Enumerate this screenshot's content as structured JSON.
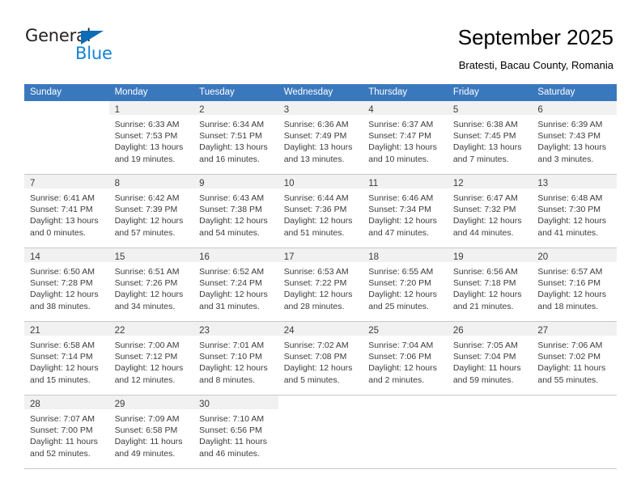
{
  "brand": {
    "name_top": "General",
    "name_bottom": "Blue",
    "triangle_color": "#0d6cb5",
    "text_color_top": "#231f20",
    "text_color_bottom": "#1583d4"
  },
  "header": {
    "title": "September 2025",
    "subtitle": "Bratesti, Bacau County, Romania"
  },
  "theme": {
    "header_bg": "#3a78bd",
    "header_text": "#ffffff",
    "daynum_band_bg": "#f1f1f1",
    "cell_border": "#c8c8c8",
    "text": "#3c3c3c"
  },
  "weekdays": [
    "Sunday",
    "Monday",
    "Tuesday",
    "Wednesday",
    "Thursday",
    "Friday",
    "Saturday"
  ],
  "weeks": [
    [
      {
        "day": "",
        "sunrise": "",
        "sunset": "",
        "daylight_1": "",
        "daylight_2": ""
      },
      {
        "day": "1",
        "sunrise": "Sunrise: 6:33 AM",
        "sunset": "Sunset: 7:53 PM",
        "daylight_1": "Daylight: 13 hours",
        "daylight_2": "and 19 minutes."
      },
      {
        "day": "2",
        "sunrise": "Sunrise: 6:34 AM",
        "sunset": "Sunset: 7:51 PM",
        "daylight_1": "Daylight: 13 hours",
        "daylight_2": "and 16 minutes."
      },
      {
        "day": "3",
        "sunrise": "Sunrise: 6:36 AM",
        "sunset": "Sunset: 7:49 PM",
        "daylight_1": "Daylight: 13 hours",
        "daylight_2": "and 13 minutes."
      },
      {
        "day": "4",
        "sunrise": "Sunrise: 6:37 AM",
        "sunset": "Sunset: 7:47 PM",
        "daylight_1": "Daylight: 13 hours",
        "daylight_2": "and 10 minutes."
      },
      {
        "day": "5",
        "sunrise": "Sunrise: 6:38 AM",
        "sunset": "Sunset: 7:45 PM",
        "daylight_1": "Daylight: 13 hours",
        "daylight_2": "and 7 minutes."
      },
      {
        "day": "6",
        "sunrise": "Sunrise: 6:39 AM",
        "sunset": "Sunset: 7:43 PM",
        "daylight_1": "Daylight: 13 hours",
        "daylight_2": "and 3 minutes."
      }
    ],
    [
      {
        "day": "7",
        "sunrise": "Sunrise: 6:41 AM",
        "sunset": "Sunset: 7:41 PM",
        "daylight_1": "Daylight: 13 hours",
        "daylight_2": "and 0 minutes."
      },
      {
        "day": "8",
        "sunrise": "Sunrise: 6:42 AM",
        "sunset": "Sunset: 7:39 PM",
        "daylight_1": "Daylight: 12 hours",
        "daylight_2": "and 57 minutes."
      },
      {
        "day": "9",
        "sunrise": "Sunrise: 6:43 AM",
        "sunset": "Sunset: 7:38 PM",
        "daylight_1": "Daylight: 12 hours",
        "daylight_2": "and 54 minutes."
      },
      {
        "day": "10",
        "sunrise": "Sunrise: 6:44 AM",
        "sunset": "Sunset: 7:36 PM",
        "daylight_1": "Daylight: 12 hours",
        "daylight_2": "and 51 minutes."
      },
      {
        "day": "11",
        "sunrise": "Sunrise: 6:46 AM",
        "sunset": "Sunset: 7:34 PM",
        "daylight_1": "Daylight: 12 hours",
        "daylight_2": "and 47 minutes."
      },
      {
        "day": "12",
        "sunrise": "Sunrise: 6:47 AM",
        "sunset": "Sunset: 7:32 PM",
        "daylight_1": "Daylight: 12 hours",
        "daylight_2": "and 44 minutes."
      },
      {
        "day": "13",
        "sunrise": "Sunrise: 6:48 AM",
        "sunset": "Sunset: 7:30 PM",
        "daylight_1": "Daylight: 12 hours",
        "daylight_2": "and 41 minutes."
      }
    ],
    [
      {
        "day": "14",
        "sunrise": "Sunrise: 6:50 AM",
        "sunset": "Sunset: 7:28 PM",
        "daylight_1": "Daylight: 12 hours",
        "daylight_2": "and 38 minutes."
      },
      {
        "day": "15",
        "sunrise": "Sunrise: 6:51 AM",
        "sunset": "Sunset: 7:26 PM",
        "daylight_1": "Daylight: 12 hours",
        "daylight_2": "and 34 minutes."
      },
      {
        "day": "16",
        "sunrise": "Sunrise: 6:52 AM",
        "sunset": "Sunset: 7:24 PM",
        "daylight_1": "Daylight: 12 hours",
        "daylight_2": "and 31 minutes."
      },
      {
        "day": "17",
        "sunrise": "Sunrise: 6:53 AM",
        "sunset": "Sunset: 7:22 PM",
        "daylight_1": "Daylight: 12 hours",
        "daylight_2": "and 28 minutes."
      },
      {
        "day": "18",
        "sunrise": "Sunrise: 6:55 AM",
        "sunset": "Sunset: 7:20 PM",
        "daylight_1": "Daylight: 12 hours",
        "daylight_2": "and 25 minutes."
      },
      {
        "day": "19",
        "sunrise": "Sunrise: 6:56 AM",
        "sunset": "Sunset: 7:18 PM",
        "daylight_1": "Daylight: 12 hours",
        "daylight_2": "and 21 minutes."
      },
      {
        "day": "20",
        "sunrise": "Sunrise: 6:57 AM",
        "sunset": "Sunset: 7:16 PM",
        "daylight_1": "Daylight: 12 hours",
        "daylight_2": "and 18 minutes."
      }
    ],
    [
      {
        "day": "21",
        "sunrise": "Sunrise: 6:58 AM",
        "sunset": "Sunset: 7:14 PM",
        "daylight_1": "Daylight: 12 hours",
        "daylight_2": "and 15 minutes."
      },
      {
        "day": "22",
        "sunrise": "Sunrise: 7:00 AM",
        "sunset": "Sunset: 7:12 PM",
        "daylight_1": "Daylight: 12 hours",
        "daylight_2": "and 12 minutes."
      },
      {
        "day": "23",
        "sunrise": "Sunrise: 7:01 AM",
        "sunset": "Sunset: 7:10 PM",
        "daylight_1": "Daylight: 12 hours",
        "daylight_2": "and 8 minutes."
      },
      {
        "day": "24",
        "sunrise": "Sunrise: 7:02 AM",
        "sunset": "Sunset: 7:08 PM",
        "daylight_1": "Daylight: 12 hours",
        "daylight_2": "and 5 minutes."
      },
      {
        "day": "25",
        "sunrise": "Sunrise: 7:04 AM",
        "sunset": "Sunset: 7:06 PM",
        "daylight_1": "Daylight: 12 hours",
        "daylight_2": "and 2 minutes."
      },
      {
        "day": "26",
        "sunrise": "Sunrise: 7:05 AM",
        "sunset": "Sunset: 7:04 PM",
        "daylight_1": "Daylight: 11 hours",
        "daylight_2": "and 59 minutes."
      },
      {
        "day": "27",
        "sunrise": "Sunrise: 7:06 AM",
        "sunset": "Sunset: 7:02 PM",
        "daylight_1": "Daylight: 11 hours",
        "daylight_2": "and 55 minutes."
      }
    ],
    [
      {
        "day": "28",
        "sunrise": "Sunrise: 7:07 AM",
        "sunset": "Sunset: 7:00 PM",
        "daylight_1": "Daylight: 11 hours",
        "daylight_2": "and 52 minutes."
      },
      {
        "day": "29",
        "sunrise": "Sunrise: 7:09 AM",
        "sunset": "Sunset: 6:58 PM",
        "daylight_1": "Daylight: 11 hours",
        "daylight_2": "and 49 minutes."
      },
      {
        "day": "30",
        "sunrise": "Sunrise: 7:10 AM",
        "sunset": "Sunset: 6:56 PM",
        "daylight_1": "Daylight: 11 hours",
        "daylight_2": "and 46 minutes."
      },
      {
        "day": "",
        "sunrise": "",
        "sunset": "",
        "daylight_1": "",
        "daylight_2": ""
      },
      {
        "day": "",
        "sunrise": "",
        "sunset": "",
        "daylight_1": "",
        "daylight_2": ""
      },
      {
        "day": "",
        "sunrise": "",
        "sunset": "",
        "daylight_1": "",
        "daylight_2": ""
      },
      {
        "day": "",
        "sunrise": "",
        "sunset": "",
        "daylight_1": "",
        "daylight_2": ""
      }
    ]
  ]
}
